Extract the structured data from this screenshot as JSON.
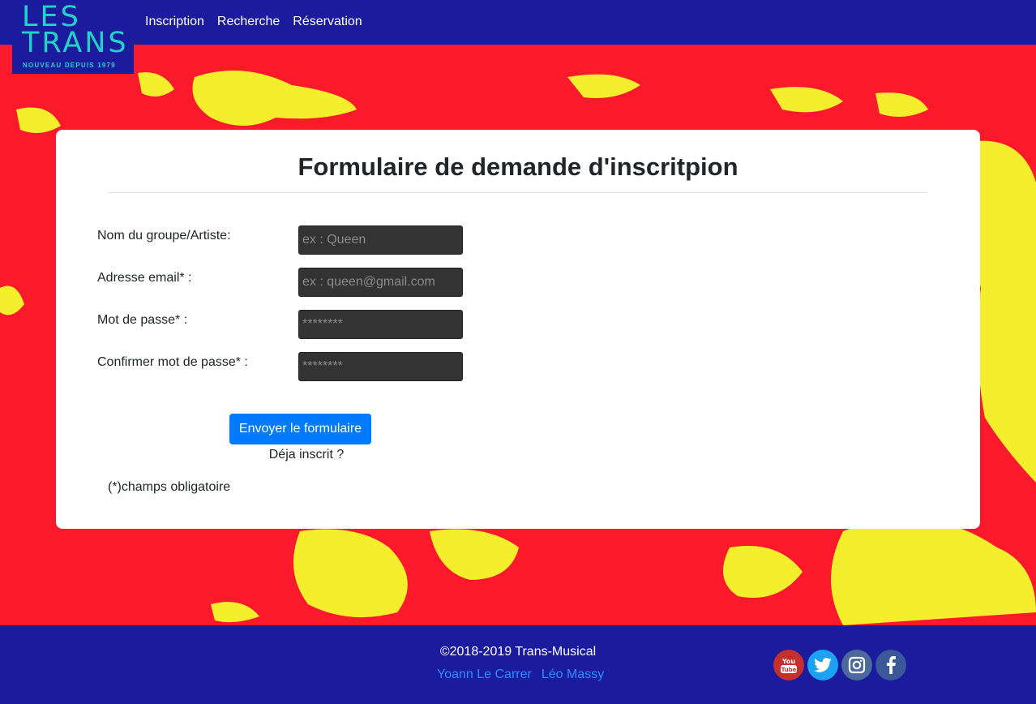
{
  "nav": {
    "logo": {
      "line1": "LES",
      "line2": "TRANS",
      "tagline": "NOUVEAU DEPUIS 1979"
    },
    "links": [
      "Inscription",
      "Recherche",
      "Réservation"
    ]
  },
  "form": {
    "title": "Formulaire de demande d'inscritpion",
    "fields": [
      {
        "label": "Nom du groupe/Artiste:",
        "placeholder": "ex : Queen",
        "type": "text"
      },
      {
        "label": "Adresse email* :",
        "placeholder": "ex : queen@gmail.com",
        "type": "email"
      },
      {
        "label": "Mot de passe* :",
        "placeholder": "********",
        "type": "password"
      },
      {
        "label": "Confirmer mot de passe* :",
        "placeholder": "********",
        "type": "password"
      }
    ],
    "submit_label": "Envoyer le formulaire",
    "already_registered": "Déja inscrit ?",
    "required_note": "(*)champs obligatoire"
  },
  "footer": {
    "copyright": "©2018-2019 Trans-Musical",
    "authors": [
      "Yoann Le Carrer",
      "Léo Massy"
    ],
    "socials": [
      {
        "name": "youtube-icon",
        "label": "You Tube"
      },
      {
        "name": "twitter-icon",
        "label": ""
      },
      {
        "name": "instagram-icon",
        "label": ""
      },
      {
        "name": "facebook-icon",
        "label": "f"
      }
    ]
  },
  "colors": {
    "nav_bg": "#1b1b9e",
    "page_bg": "#fb1a2c",
    "splash": "#f5ee2c",
    "primary": "#007bff",
    "logo_teal": "#22d3c5",
    "logo_red": "#fb1a2c"
  }
}
